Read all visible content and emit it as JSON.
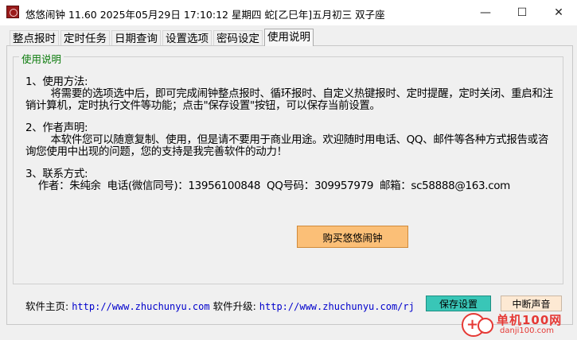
{
  "window": {
    "title": "悠悠闹钟 11.60 2025年05月29日 17:10:12 星期四 蛇[乙巳年]五月初三 双子座",
    "minimize_glyph": "—",
    "maximize_glyph": "☐",
    "close_glyph": "✕"
  },
  "tabs": [
    {
      "label": "整点报时"
    },
    {
      "label": "定时任务"
    },
    {
      "label": "日期查询"
    },
    {
      "label": "设置选项"
    },
    {
      "label": "密码设定"
    },
    {
      "label": "使用说明"
    }
  ],
  "group": {
    "legend": "使用说明",
    "legend_color": "#0a7a0a"
  },
  "content": {
    "section1_title": "1、使用方法:",
    "section1_text": "        将需要的选项选中后，即可完成闹钟整点报时、循环报时、自定义热键报时、定时提醒，定时关闭、重启和注销计算机，定时执行文件等功能；点击\"保存设置\"按钮，可以保存当前设置。",
    "section2_title": "2、作者声明:",
    "section2_text": "        本软件您可以随意复制、使用，但是请不要用于商业用途。欢迎随时用电话、QQ、邮件等各种方式报告或咨询您使用中出现的问题，您的支持是我完善软件的动力！",
    "section3_title": "3、联系方式:",
    "contact_line": "    作者：朱纯余  电话(微信同号)：13956100848  QQ号码：309957979  邮箱：sc58888@163.com"
  },
  "buttons": {
    "buy": "购买悠悠闹钟",
    "buy_color": "#fbbf77",
    "save": "保存设置",
    "save_color": "#39c6b7",
    "stop_sound": "中断声音",
    "stop_color": "#fde9d3"
  },
  "footer": {
    "home_label": "软件主页:",
    "home_url": "http://www.zhuchunyu.com",
    "upgrade_label": "软件升级:",
    "upgrade_url": "http://www.zhuchunyu.com/rj"
  },
  "watermark": {
    "name": "单机100网",
    "url": "danji100.com",
    "color": "#e53935"
  }
}
